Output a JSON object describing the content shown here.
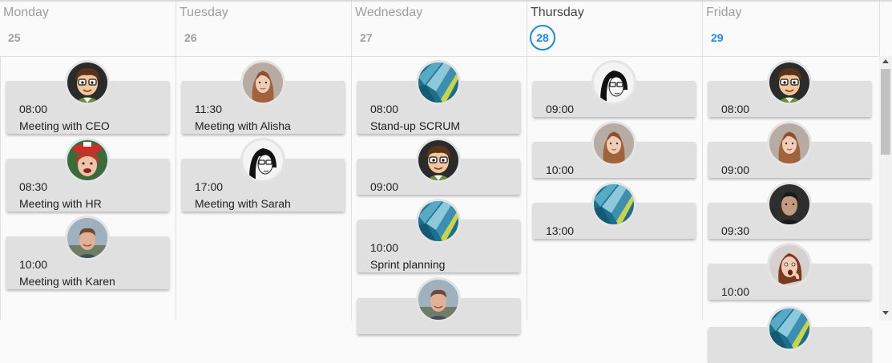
{
  "days": [
    {
      "name": "Monday",
      "num": "25"
    },
    {
      "name": "Tuesday",
      "num": "26"
    },
    {
      "name": "Wednesday",
      "num": "27"
    },
    {
      "name": "Thursday",
      "num": "28"
    },
    {
      "name": "Friday",
      "num": "29"
    }
  ],
  "events": {
    "monday": [
      {
        "time": "08:00",
        "title": "Meeting with CEO",
        "avatar": "cartoon-avatar-icon"
      },
      {
        "time": "08:30",
        "title": "Meeting with HR",
        "avatar": "woman-red-hat-avatar"
      },
      {
        "time": "10:00",
        "title": "Meeting with Karen",
        "avatar": "man-outdoor-avatar"
      }
    ],
    "tuesday": [
      {
        "time": "11:30",
        "title": "Meeting with Alisha",
        "avatar": "woman-portrait-avatar"
      },
      {
        "time": "17:00",
        "title": "Meeting with Sarah",
        "avatar": "woman-glasses-avatar"
      }
    ],
    "wednesday": [
      {
        "time": "08:00",
        "title": "Stand-up SCRUM",
        "avatar": "team-logo-icon"
      },
      {
        "time": "09:00",
        "title": "",
        "avatar": "cartoon-avatar-icon"
      },
      {
        "time": "10:00",
        "title": "Sprint planning",
        "avatar": "team-logo-icon"
      },
      {
        "time": "",
        "title": "",
        "avatar": "man-outdoor-avatar"
      }
    ],
    "thursday": [
      {
        "time": "09:00",
        "title": "",
        "avatar": "woman-glasses-avatar"
      },
      {
        "time": "10:00",
        "title": "",
        "avatar": "woman-portrait-avatar"
      },
      {
        "time": "13:00",
        "title": "",
        "avatar": "team-logo-icon"
      }
    ],
    "friday": [
      {
        "time": "08:00",
        "title": "",
        "avatar": "cartoon-avatar-icon"
      },
      {
        "time": "09:00",
        "title": "",
        "avatar": "woman-portrait-avatar"
      },
      {
        "time": "09:30",
        "title": "",
        "avatar": "man-dark-avatar"
      },
      {
        "time": "10:00",
        "title": "",
        "avatar": "woman-surprised-avatar"
      },
      {
        "time": "",
        "title": "",
        "avatar": "team-logo-icon"
      }
    ]
  },
  "colors": {
    "today_accent": "#1e88e5",
    "event_bg": "#e0e0e0"
  }
}
